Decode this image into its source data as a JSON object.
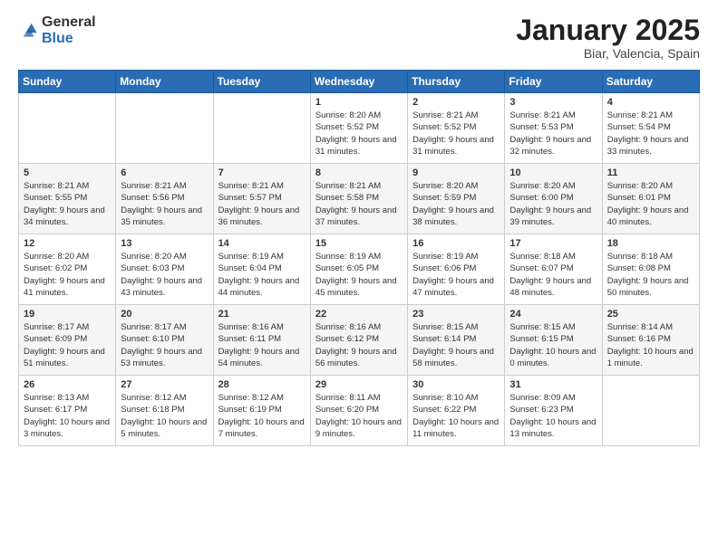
{
  "header": {
    "logo_general": "General",
    "logo_blue": "Blue",
    "title": "January 2025",
    "subtitle": "Biar, Valencia, Spain"
  },
  "days_of_week": [
    "Sunday",
    "Monday",
    "Tuesday",
    "Wednesday",
    "Thursday",
    "Friday",
    "Saturday"
  ],
  "weeks": [
    [
      {
        "day": "",
        "info": ""
      },
      {
        "day": "",
        "info": ""
      },
      {
        "day": "",
        "info": ""
      },
      {
        "day": "1",
        "info": "Sunrise: 8:20 AM\nSunset: 5:52 PM\nDaylight: 9 hours\nand 31 minutes."
      },
      {
        "day": "2",
        "info": "Sunrise: 8:21 AM\nSunset: 5:52 PM\nDaylight: 9 hours\nand 31 minutes."
      },
      {
        "day": "3",
        "info": "Sunrise: 8:21 AM\nSunset: 5:53 PM\nDaylight: 9 hours\nand 32 minutes."
      },
      {
        "day": "4",
        "info": "Sunrise: 8:21 AM\nSunset: 5:54 PM\nDaylight: 9 hours\nand 33 minutes."
      }
    ],
    [
      {
        "day": "5",
        "info": "Sunrise: 8:21 AM\nSunset: 5:55 PM\nDaylight: 9 hours\nand 34 minutes."
      },
      {
        "day": "6",
        "info": "Sunrise: 8:21 AM\nSunset: 5:56 PM\nDaylight: 9 hours\nand 35 minutes."
      },
      {
        "day": "7",
        "info": "Sunrise: 8:21 AM\nSunset: 5:57 PM\nDaylight: 9 hours\nand 36 minutes."
      },
      {
        "day": "8",
        "info": "Sunrise: 8:21 AM\nSunset: 5:58 PM\nDaylight: 9 hours\nand 37 minutes."
      },
      {
        "day": "9",
        "info": "Sunrise: 8:20 AM\nSunset: 5:59 PM\nDaylight: 9 hours\nand 38 minutes."
      },
      {
        "day": "10",
        "info": "Sunrise: 8:20 AM\nSunset: 6:00 PM\nDaylight: 9 hours\nand 39 minutes."
      },
      {
        "day": "11",
        "info": "Sunrise: 8:20 AM\nSunset: 6:01 PM\nDaylight: 9 hours\nand 40 minutes."
      }
    ],
    [
      {
        "day": "12",
        "info": "Sunrise: 8:20 AM\nSunset: 6:02 PM\nDaylight: 9 hours\nand 41 minutes."
      },
      {
        "day": "13",
        "info": "Sunrise: 8:20 AM\nSunset: 6:03 PM\nDaylight: 9 hours\nand 43 minutes."
      },
      {
        "day": "14",
        "info": "Sunrise: 8:19 AM\nSunset: 6:04 PM\nDaylight: 9 hours\nand 44 minutes."
      },
      {
        "day": "15",
        "info": "Sunrise: 8:19 AM\nSunset: 6:05 PM\nDaylight: 9 hours\nand 45 minutes."
      },
      {
        "day": "16",
        "info": "Sunrise: 8:19 AM\nSunset: 6:06 PM\nDaylight: 9 hours\nand 47 minutes."
      },
      {
        "day": "17",
        "info": "Sunrise: 8:18 AM\nSunset: 6:07 PM\nDaylight: 9 hours\nand 48 minutes."
      },
      {
        "day": "18",
        "info": "Sunrise: 8:18 AM\nSunset: 6:08 PM\nDaylight: 9 hours\nand 50 minutes."
      }
    ],
    [
      {
        "day": "19",
        "info": "Sunrise: 8:17 AM\nSunset: 6:09 PM\nDaylight: 9 hours\nand 51 minutes."
      },
      {
        "day": "20",
        "info": "Sunrise: 8:17 AM\nSunset: 6:10 PM\nDaylight: 9 hours\nand 53 minutes."
      },
      {
        "day": "21",
        "info": "Sunrise: 8:16 AM\nSunset: 6:11 PM\nDaylight: 9 hours\nand 54 minutes."
      },
      {
        "day": "22",
        "info": "Sunrise: 8:16 AM\nSunset: 6:12 PM\nDaylight: 9 hours\nand 56 minutes."
      },
      {
        "day": "23",
        "info": "Sunrise: 8:15 AM\nSunset: 6:14 PM\nDaylight: 9 hours\nand 58 minutes."
      },
      {
        "day": "24",
        "info": "Sunrise: 8:15 AM\nSunset: 6:15 PM\nDaylight: 10 hours\nand 0 minutes."
      },
      {
        "day": "25",
        "info": "Sunrise: 8:14 AM\nSunset: 6:16 PM\nDaylight: 10 hours\nand 1 minute."
      }
    ],
    [
      {
        "day": "26",
        "info": "Sunrise: 8:13 AM\nSunset: 6:17 PM\nDaylight: 10 hours\nand 3 minutes."
      },
      {
        "day": "27",
        "info": "Sunrise: 8:12 AM\nSunset: 6:18 PM\nDaylight: 10 hours\nand 5 minutes."
      },
      {
        "day": "28",
        "info": "Sunrise: 8:12 AM\nSunset: 6:19 PM\nDaylight: 10 hours\nand 7 minutes."
      },
      {
        "day": "29",
        "info": "Sunrise: 8:11 AM\nSunset: 6:20 PM\nDaylight: 10 hours\nand 9 minutes."
      },
      {
        "day": "30",
        "info": "Sunrise: 8:10 AM\nSunset: 6:22 PM\nDaylight: 10 hours\nand 11 minutes."
      },
      {
        "day": "31",
        "info": "Sunrise: 8:09 AM\nSunset: 6:23 PM\nDaylight: 10 hours\nand 13 minutes."
      },
      {
        "day": "",
        "info": ""
      }
    ]
  ]
}
